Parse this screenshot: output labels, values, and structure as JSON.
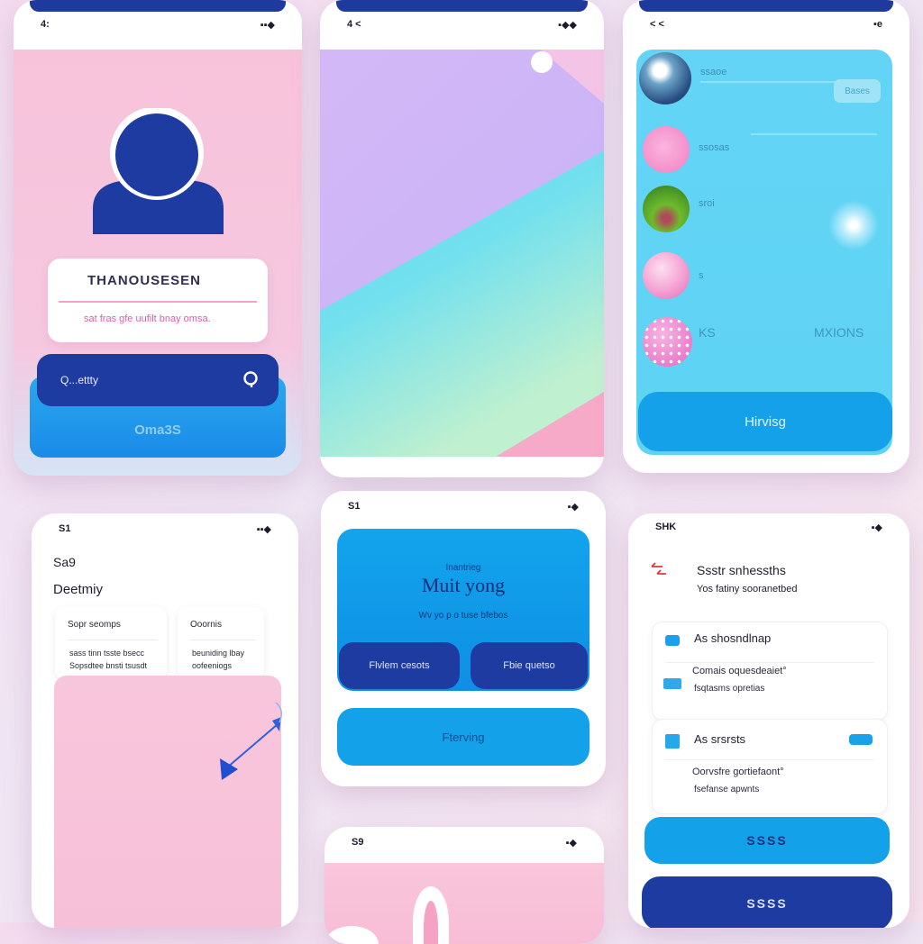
{
  "colors": {
    "navy": "#1e3ba2",
    "sky": "#11a3ea",
    "pink": "#f7c3d9",
    "cyan": "#5fd8f2",
    "lavender": "#d8c1f5"
  },
  "screen1": {
    "status_left": "4:",
    "status_right": "▪▪◆",
    "card_title": "THANOUSESEN",
    "card_subtitle": "sat fras gfe uufilt bnay omsa.",
    "search_value": "Q...ettty",
    "search_icon": "search-icon",
    "button_label": "Oma3S"
  },
  "screen2": {
    "status_left": "4 <",
    "status_right": "▪◆◆"
  },
  "screen3": {
    "status_left": "< <",
    "status_right": "▪e",
    "rows": [
      {
        "title": "ssaoe",
        "avatar": "mountain-photo"
      },
      {
        "title": "ssosas",
        "avatar": "pink-circle"
      },
      {
        "title": "sroi",
        "avatar": "tree-photo"
      },
      {
        "title": "s",
        "avatar": "pink-sphere"
      },
      {
        "title": "KS",
        "avatar": "dotted-sphere"
      }
    ],
    "pill_label": "Bases",
    "side_label": "MXIONS",
    "button_label": "Hirvisg"
  },
  "screen4": {
    "status_left": "S1",
    "status_right": "▪▪◆",
    "heading_small": "Sa9",
    "heading": "Deetmiy",
    "cards": [
      {
        "title": "Sopr seomps",
        "line1": "sass tinn tsste bsecc",
        "line2": "Sopsdtee bnsti tsusdt"
      },
      {
        "title": "Ooornis",
        "line1": "beuniding lbay",
        "line2": "oofeeniogs"
      }
    ]
  },
  "screen5": {
    "status_left": "S1",
    "status_right": "▪◆",
    "eyebrow": "Inantrieg",
    "title": "Muit yong",
    "subtitle": "Wv yo p o tuse bfebos",
    "button_left": "Flvlem cesots",
    "button_right": "Fbie quetso",
    "button_wide": "Fterving"
  },
  "screen6": {
    "status_left": "SHK",
    "status_right": "▪◆",
    "header_icon": "back-arrow-icon",
    "header_title": "Ssstr snhessths",
    "header_subtitle": "Yos fatiny sooranetbed",
    "sections": [
      {
        "title": "As shosndlnap",
        "line1": "Comais oquesdeaiet°",
        "line2": "fsqtasms opretias"
      },
      {
        "title": "As srsrsts",
        "line1": "Oorvsfre gortiefaont°",
        "line2": "fsefanse apwnts"
      }
    ],
    "button_primary": "SSSS",
    "button_secondary": "SSSS"
  },
  "screen7": {
    "status_left": "S9",
    "status_right": "▪◆"
  }
}
